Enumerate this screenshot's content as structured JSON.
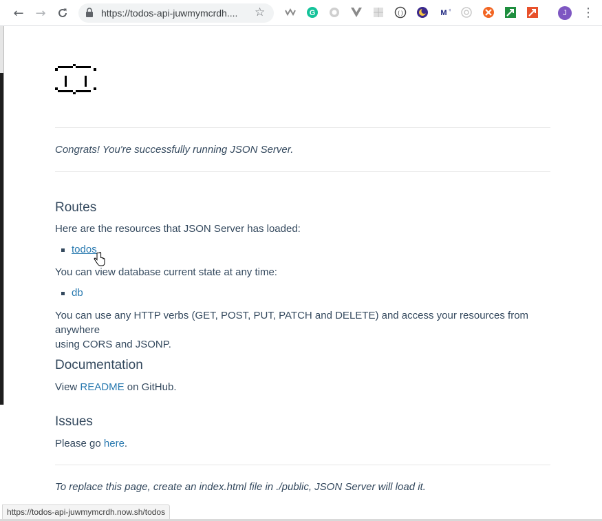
{
  "browser": {
    "url": "https://todos-api-juwmymcrdh....",
    "avatar_initial": "J"
  },
  "page": {
    "intro": "Congrats! You're successfully running JSON Server.",
    "routes": {
      "heading": "Routes",
      "resources_text": "Here are the resources that JSON Server has loaded:",
      "resources": [
        "todos"
      ],
      "db_text": "You can view database current state at any time:",
      "db_link": "db",
      "verbs_text_line1": "You can use any HTTP verbs (GET, POST, PUT, PATCH and DELETE) and access your resources from anywhere",
      "verbs_text_line2": "using CORS and JSONP."
    },
    "documentation": {
      "heading": "Documentation",
      "prefix": "View ",
      "link": "README",
      "suffix": " on GitHub."
    },
    "issues": {
      "heading": "Issues",
      "prefix": "Please go ",
      "link": "here",
      "suffix": "."
    },
    "footer": "To replace this page, create an index.html file in ./public, JSON Server will load it."
  },
  "status_url": "https://todos-api-juwmymcrdh.now.sh/todos",
  "colors": {
    "text": "#34495e",
    "link": "#2a7ab0",
    "avatar": "#7e57c2"
  }
}
